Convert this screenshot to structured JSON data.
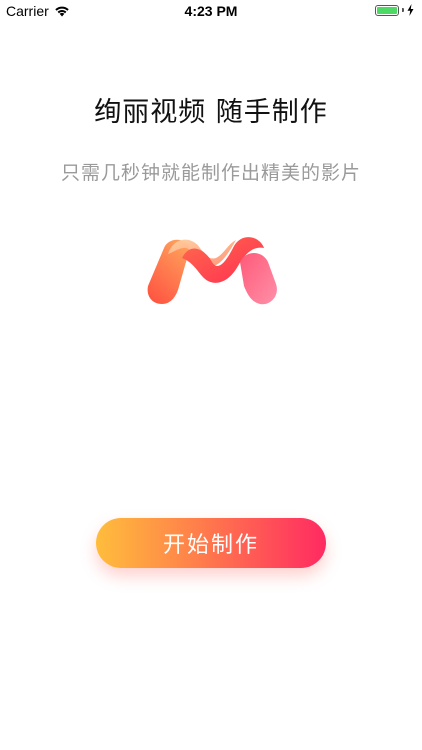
{
  "status_bar": {
    "carrier": "Carrier",
    "time": "4:23 PM",
    "battery_level": 1.0,
    "battery_color": "#4cd964"
  },
  "main": {
    "headline": "绚丽视频 随手制作",
    "subtitle": "只需几秒钟就能制作出精美的影片",
    "logo_icon": "m-wave-logo",
    "start_button_label": "开始制作",
    "button_gradient": [
      "#ffbd3c",
      "#ff7d4b",
      "#ff2a62"
    ]
  }
}
